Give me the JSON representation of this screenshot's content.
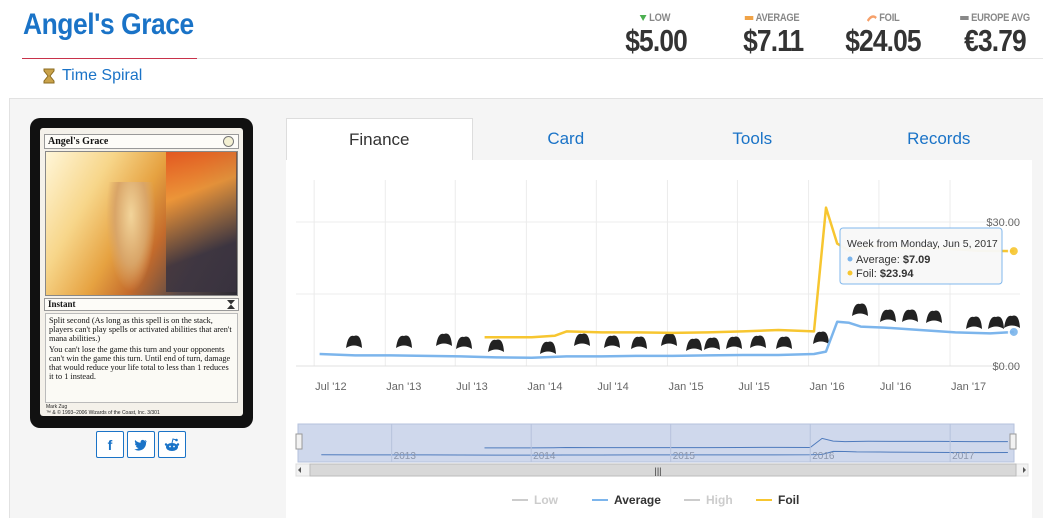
{
  "card": {
    "title": "Angel's Grace",
    "set": "Time Spiral",
    "image": {
      "name": "Angel's Grace",
      "type_line": "Instant",
      "rules_1": "Split second (As long as this spell is on the stack, players can't play spells or activated abilities that aren't mana abilities.)",
      "rules_2": "You can't lose the game this turn and your opponents can't win the game this turn. Until end of turn, damage that would reduce your life total to less than 1 reduces it to 1 instead.",
      "artist": "Mark Zug",
      "copyright": "™ & © 1993–2006 Wizards of the Coast, Inc. 3/301"
    }
  },
  "prices": [
    {
      "label": "LOW",
      "value": "$5.00",
      "marker": "triangle-down-icon",
      "color": "#4caf50"
    },
    {
      "label": "AVERAGE",
      "value": "$7.11",
      "marker": "bar",
      "color": "#f0a347"
    },
    {
      "label": "FOIL",
      "value": "$24.05",
      "marker": "swoosh-icon",
      "color": "#f6a06a"
    },
    {
      "label": "EUROPE AVG",
      "value": "€3.79",
      "marker": "bar",
      "color": "#888888"
    }
  ],
  "tabs": [
    {
      "label": "Finance",
      "active": true
    },
    {
      "label": "Card",
      "active": false
    },
    {
      "label": "Tools",
      "active": false
    },
    {
      "label": "Records",
      "active": false
    }
  ],
  "share": [
    {
      "name": "facebook-icon",
      "glyph": "f"
    },
    {
      "name": "twitter-icon",
      "glyph": "🐦"
    },
    {
      "name": "reddit-icon",
      "glyph": "👽"
    }
  ],
  "tooltip": {
    "title": "Week from Monday, Jun 5, 2017",
    "avg_label": "Average: ",
    "avg_value": "$7.09",
    "foil_label": "Foil: ",
    "foil_value": "$23.94"
  },
  "legend": [
    {
      "name": "Low",
      "color": "#cccccc",
      "active": false
    },
    {
      "name": "Average",
      "color": "#7cb5ec",
      "active": true
    },
    {
      "name": "High",
      "color": "#cccccc",
      "active": false
    },
    {
      "name": "Foil",
      "color": "#f7c630",
      "active": true
    }
  ],
  "navigator": {
    "year_labels": [
      "2013",
      "2014",
      "2015",
      "2016",
      "2017"
    ],
    "scroll_grip": "|||"
  },
  "chart_data": {
    "type": "line",
    "x_tick_labels": [
      "Jul '12",
      "Jan '13",
      "Jul '13",
      "Jan '14",
      "Jul '14",
      "Jan '15",
      "Jul '15",
      "Jan '16",
      "Jul '16",
      "Jan '17"
    ],
    "y_tick_labels": [
      "$0.00",
      "$30.00"
    ],
    "ylim": [
      0,
      30
    ],
    "series": [
      {
        "name": "Average",
        "color": "#7cb5ec",
        "x": [
          "2012-07",
          "2012-10",
          "2013-01",
          "2013-04",
          "2013-07",
          "2013-10",
          "2014-01",
          "2014-04",
          "2014-07",
          "2014-10",
          "2015-01",
          "2015-04",
          "2015-07",
          "2015-10",
          "2016-01",
          "2016-02",
          "2016-03",
          "2016-04",
          "2016-05",
          "2016-07",
          "2016-10",
          "2017-01",
          "2017-04",
          "2017-06"
        ],
        "values": [
          2.5,
          2.2,
          2.2,
          2.1,
          2.0,
          1.8,
          1.7,
          2.0,
          2.0,
          2.1,
          2.1,
          2.2,
          2.3,
          2.3,
          2.5,
          3.0,
          9.2,
          9.0,
          8.2,
          8.0,
          7.5,
          7.0,
          6.8,
          7.09
        ]
      },
      {
        "name": "Foil",
        "color": "#f7c630",
        "x": [
          "2013-09",
          "2014-01",
          "2014-03",
          "2014-04",
          "2014-07",
          "2014-10",
          "2015-01",
          "2015-04",
          "2015-07",
          "2015-10",
          "2016-01",
          "2016-02",
          "2016-03",
          "2016-04",
          "2016-06",
          "2016-09",
          "2016-12",
          "2017-03",
          "2017-06"
        ],
        "values": [
          6.0,
          6.0,
          6.3,
          7.2,
          7.0,
          7.0,
          6.9,
          7.0,
          7.2,
          7.5,
          7.2,
          33.0,
          25.5,
          24.0,
          25.0,
          24.5,
          24.5,
          24.0,
          23.94
        ]
      }
    ],
    "grid": true,
    "legend_position": "bottom-center"
  }
}
